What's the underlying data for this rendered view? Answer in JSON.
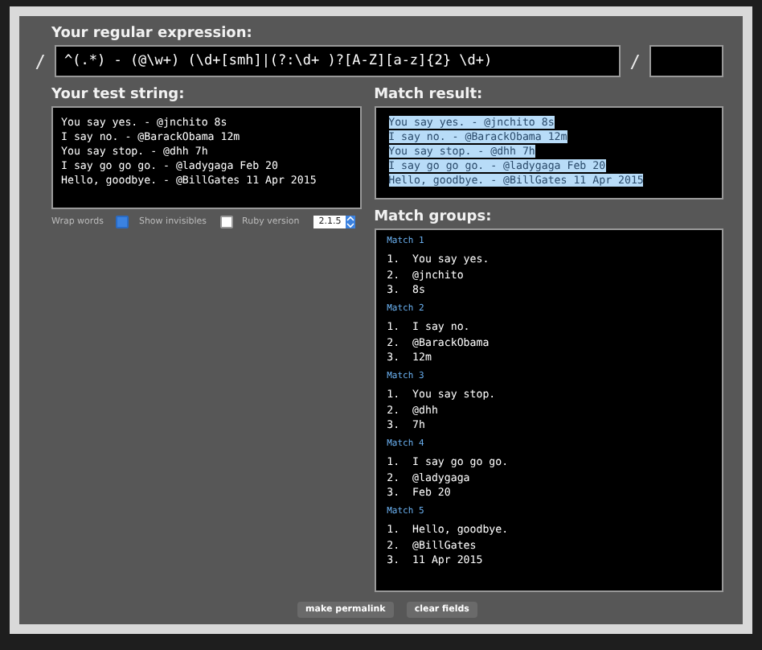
{
  "regex": {
    "label": "Your regular expression:",
    "delimiter_open": "/",
    "pattern": "^(.*) - (@\\w+) (\\d+[smh]|(?:\\d+ )?[A-Z][a-z]{2} \\d+)",
    "delimiter_close": "/"
  },
  "test_string": {
    "label": "Your test string:",
    "lines": [
      "You say yes. - @jnchito 8s",
      "I say no. - @BarackObama 12m",
      "You say stop. - @dhh 7h",
      "I say go go go. - @ladygaga Feb 20",
      "Hello, goodbye. - @BillGates 11 Apr 2015"
    ]
  },
  "settings": [
    {
      "kind": "checkbox",
      "label": "Wrap words",
      "checked": true
    },
    {
      "kind": "checkbox",
      "label": "Show invisibles",
      "checked": false
    },
    {
      "kind": "select",
      "label": "Ruby version",
      "value": "2.1.5"
    }
  ],
  "match_result": {
    "label": "Match result:",
    "lines": [
      "You say yes. - @jnchito 8s",
      "I say no. - @BarackObama 12m",
      "You say stop. - @dhh 7h",
      "I say go go go. - @ladygaga Feb 20",
      "Hello, goodbye. - @BillGates 11 Apr 2015"
    ]
  },
  "match_groups": {
    "label": "Match groups:",
    "matches": [
      {
        "title": "Match 1",
        "groups": [
          {
            "index": "1.",
            "text": "You say yes."
          },
          {
            "index": "2.",
            "text": "@jnchito"
          },
          {
            "index": "3.",
            "text": "8s"
          }
        ]
      },
      {
        "title": "Match 2",
        "groups": [
          {
            "index": "1.",
            "text": "I say no."
          },
          {
            "index": "2.",
            "text": "@BarackObama"
          },
          {
            "index": "3.",
            "text": "12m"
          }
        ]
      },
      {
        "title": "Match 3",
        "groups": [
          {
            "index": "1.",
            "text": "You say stop."
          },
          {
            "index": "2.",
            "text": "@dhh"
          },
          {
            "index": "3.",
            "text": "7h"
          }
        ]
      },
      {
        "title": "Match 4",
        "groups": [
          {
            "index": "1.",
            "text": "I say go go go."
          },
          {
            "index": "2.",
            "text": "@ladygaga"
          },
          {
            "index": "3.",
            "text": "Feb 20"
          }
        ]
      },
      {
        "title": "Match 5",
        "groups": [
          {
            "index": "1.",
            "text": "Hello, goodbye."
          },
          {
            "index": "2.",
            "text": "@BillGates"
          },
          {
            "index": "3.",
            "text": "11 Apr 2015"
          }
        ]
      }
    ]
  },
  "buttons": [
    "make permalink",
    "clear fields"
  ]
}
